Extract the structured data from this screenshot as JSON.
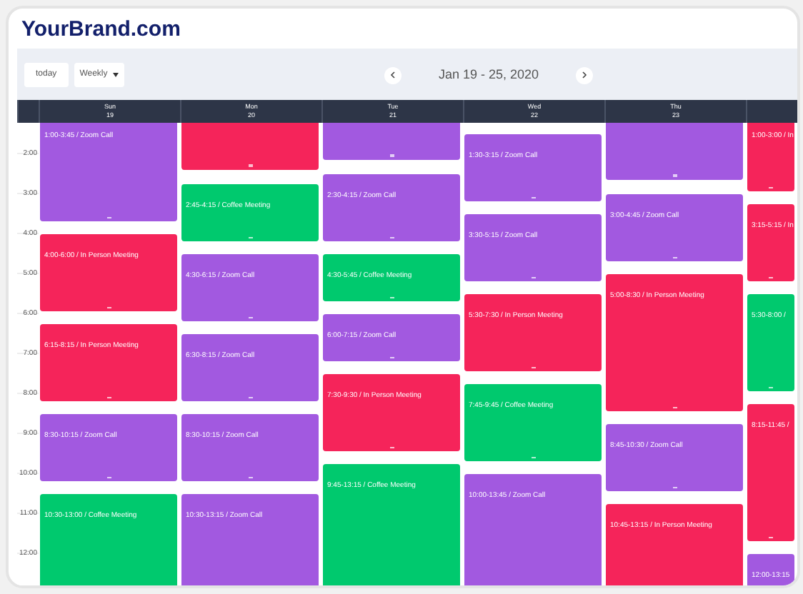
{
  "brand": "YourBrand.com",
  "toolbar": {
    "today": "today",
    "view": "Weekly",
    "title": "Jan 19 - 25, 2020"
  },
  "hours": [
    "2:00",
    "3:00",
    "4:00",
    "5:00",
    "6:00",
    "7:00",
    "8:00",
    "9:00",
    "10:00",
    "11:00",
    "12:00"
  ],
  "days": [
    {
      "name": "Sun",
      "date": "19",
      "events": [
        {
          "label": "1:00-3:45 / Zoom Call",
          "color": "#a259e0"
        },
        {
          "label": "4:00-6:00 / In Person Meeting",
          "color": "#f5245a"
        },
        {
          "label": "6:15-8:15 / In Person Meeting",
          "color": "#f5245a"
        },
        {
          "label": "8:30-10:15 / Zoom Call",
          "color": "#a259e0"
        },
        {
          "label": "10:30-13:00 / Coffee Meeting",
          "color": "#00c96e"
        }
      ]
    },
    {
      "name": "Mon",
      "date": "20",
      "events": [
        {
          "color": "#f5245a"
        },
        {
          "label": "2:45-4:15 / Coffee Meeting",
          "color": "#00c96e"
        },
        {
          "label": "4:30-6:15 / Zoom Call",
          "color": "#a259e0"
        },
        {
          "label": "6:30-8:15 / Zoom Call",
          "color": "#a259e0"
        },
        {
          "label": "8:30-10:15 / Zoom Call",
          "color": "#a259e0"
        },
        {
          "label": "10:30-13:15 / Zoom Call",
          "color": "#a259e0"
        }
      ]
    },
    {
      "name": "Tue",
      "date": "21",
      "events": [
        {
          "color": "#a259e0"
        },
        {
          "label": "2:30-4:15 / Zoom Call",
          "color": "#a259e0"
        },
        {
          "label": "4:30-5:45 / Coffee Meeting",
          "color": "#00c96e"
        },
        {
          "label": "6:00-7:15 / Zoom Call",
          "color": "#a259e0"
        },
        {
          "label": "7:30-9:30 / In Person Meeting",
          "color": "#f5245a"
        },
        {
          "label": "9:45-13:15 / Coffee Meeting",
          "color": "#00c96e"
        }
      ]
    },
    {
      "name": "Wed",
      "date": "22",
      "events": [
        {
          "label": "1:30-3:15 / Zoom Call",
          "color": "#a259e0"
        },
        {
          "label": "3:30-5:15 / Zoom Call",
          "color": "#a259e0"
        },
        {
          "label": "5:30-7:30 / In Person Meeting",
          "color": "#f5245a"
        },
        {
          "label": "7:45-9:45 / Coffee Meeting",
          "color": "#00c96e"
        },
        {
          "label": "10:00-13:45 / Zoom Call",
          "color": "#a259e0"
        }
      ]
    },
    {
      "name": "Thu",
      "date": "23",
      "events": [
        {
          "color": "#a259e0"
        },
        {
          "label": "3:00-4:45 / Zoom Call",
          "color": "#a259e0"
        },
        {
          "label": "5:00-8:30 / In Person Meeting",
          "color": "#f5245a"
        },
        {
          "label": "8:45-10:30 / Zoom Call",
          "color": "#a259e0"
        },
        {
          "label": "10:45-13:15 / In Person Meeting",
          "color": "#f5245a"
        }
      ]
    },
    {
      "events": [
        {
          "label": "1:00-3:00 / In",
          "color": "#f5245a"
        },
        {
          "label": "3:15-5:15 / In",
          "color": "#f5245a"
        },
        {
          "label": "5:30-8:00 /",
          "color": "#00c96e"
        },
        {
          "label": "8:15-11:45 /",
          "color": "#f5245a"
        },
        {
          "label": "12:00-13:15",
          "color": "#a259e0"
        }
      ]
    }
  ]
}
